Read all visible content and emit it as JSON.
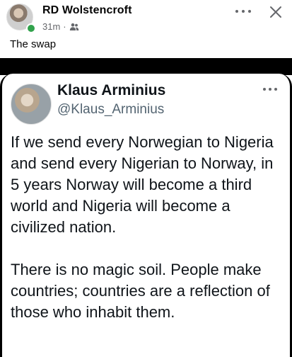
{
  "post": {
    "author": "RD Wolstencroft",
    "time": "31m",
    "separator": "·",
    "audience_icon": "friends-icon",
    "caption": "The swap",
    "more_icon": "more-horizontal-icon",
    "close_icon": "close-icon"
  },
  "tweet": {
    "name": "Klaus Arminius",
    "handle": "@Klaus_Arminius",
    "paragraphs": [
      "If we send every Norwegian to Nigeria and send every Nigerian to Norway, in 5 years Norway will become a third world and Nigeria will become a civilized nation.",
      "There is no magic soil. People make countries; countries are a reflection of those who inhabit them."
    ]
  },
  "colors": {
    "online": "#31a24c",
    "meta_text": "#65676b",
    "handle_text": "#536471"
  }
}
